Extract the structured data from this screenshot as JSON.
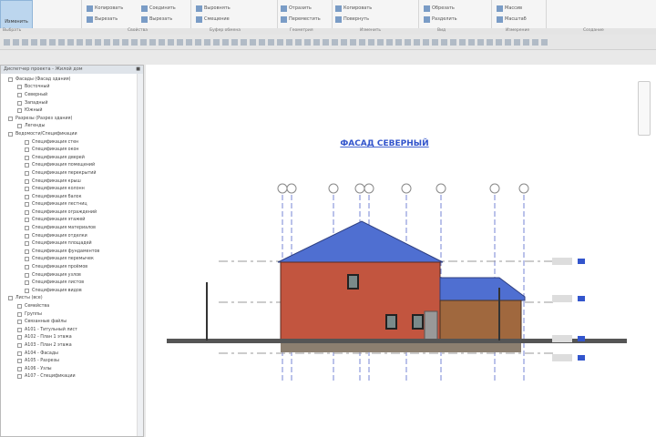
{
  "ribbon": {
    "modify_label": "Изменить",
    "groups": [
      "Выбрать",
      "Свойства",
      "Буфер обмена",
      "Геометрия",
      "Изменить",
      "Вид",
      "Измерение",
      "Создание"
    ],
    "items": [
      "Копировать",
      "Вырезать",
      "Соединить",
      "Вырезать",
      "Выровнять",
      "Смещение",
      "Отразить",
      "Переместить",
      "Копировать",
      "Повернуть",
      "Обрезать",
      "Разделить",
      "Массив",
      "Масштаб"
    ]
  },
  "browser": {
    "title": "Диспетчер проекта - Жилой дом",
    "items": [
      "Фасады (Фасад здания)",
      "Восточный",
      "Северный",
      "Западный",
      "Южный",
      "Разрезы (Разрез здания)",
      "Легенды",
      "Ведомости/Спецификации",
      "Спецификация стен",
      "Спецификация окон",
      "Спецификация дверей",
      "Спецификация помещений",
      "Спецификация перекрытий",
      "Спецификация крыш",
      "Спецификация колонн",
      "Спецификация балок",
      "Спецификация лестниц",
      "Спецификация ограждений",
      "Спецификация этажей",
      "Спецификация материалов",
      "Спецификация отделки",
      "Спецификация площадей",
      "Спецификация фундаментов",
      "Спецификация перемычек",
      "Спецификация проёмов",
      "Спецификация узлов",
      "Спецификация листов",
      "Спецификация видов",
      "Листы (все)",
      "Семейства",
      "Группы",
      "Связанные файлы",
      "A101 - Титульный лист",
      "A102 - План 1 этажа",
      "A103 - План 2 этажа",
      "A104 - Фасады",
      "A105 - Разрезы",
      "A106 - Узлы",
      "A107 - Спецификации"
    ]
  },
  "view": {
    "title": "ФАСАД СЕВЕРНЫЙ",
    "grid_count": 9,
    "levels": 4
  },
  "colors": {
    "roof": "#4f6fd1",
    "brick": "#c2553f",
    "garage": "#a0683e",
    "accent": "#3355cc"
  }
}
